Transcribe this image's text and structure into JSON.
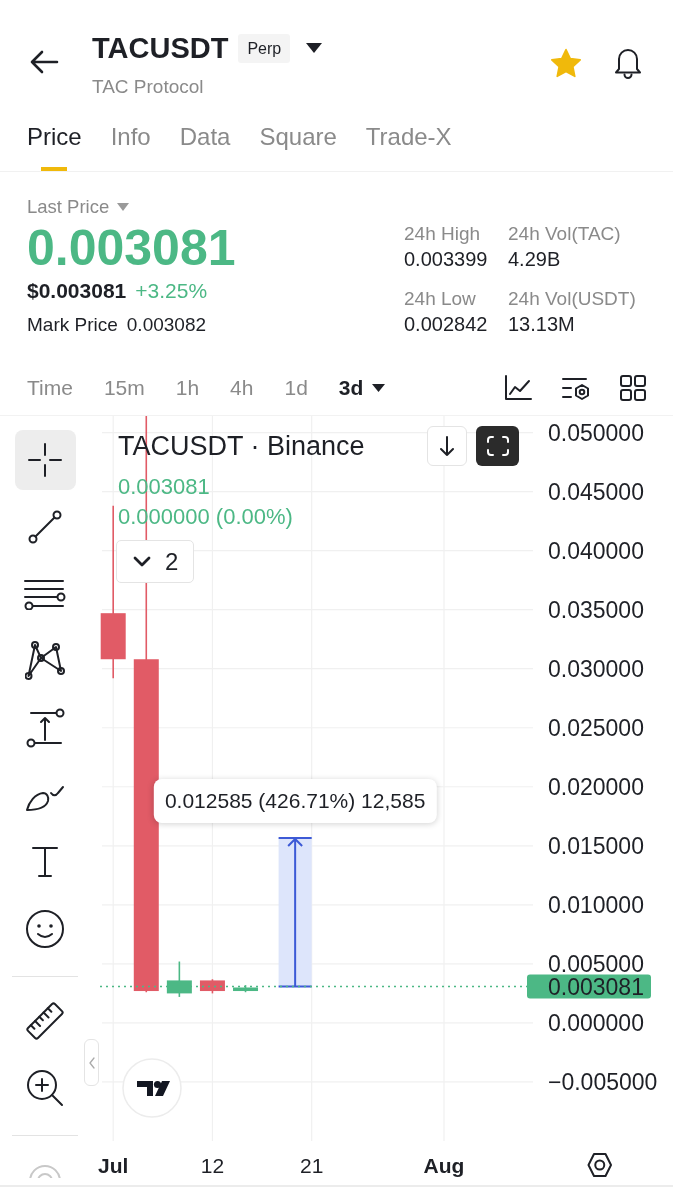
{
  "header": {
    "title": "TACUSDT",
    "badge": "Perp",
    "subtitle": "TAC Protocol",
    "favorite": true
  },
  "tabs": [
    {
      "label": "Price",
      "selected": true
    },
    {
      "label": "Info",
      "selected": false
    },
    {
      "label": "Data",
      "selected": false
    },
    {
      "label": "Square",
      "selected": false
    },
    {
      "label": "Trade-X",
      "selected": false
    }
  ],
  "ticker": {
    "label": "Last Price",
    "last_price": "0.003081",
    "rising": true,
    "usd_price": "$0.003081",
    "change": "+3.25%",
    "mark_label": "Mark Price",
    "mark_price": "0.003082"
  },
  "stats": [
    {
      "label": "24h High",
      "value": "0.003399"
    },
    {
      "label": "24h Vol(TAC)",
      "value": "4.29B"
    },
    {
      "label": "24h Low",
      "value": "0.002842"
    },
    {
      "label": "24h Vol(USDT)",
      "value": "13.13M"
    }
  ],
  "intervals": [
    {
      "label": "Time",
      "selected": false,
      "dropdown": false
    },
    {
      "label": "15m",
      "selected": false,
      "dropdown": false
    },
    {
      "label": "1h",
      "selected": false,
      "dropdown": false
    },
    {
      "label": "4h",
      "selected": false,
      "dropdown": false
    },
    {
      "label": "1d",
      "selected": false,
      "dropdown": false
    },
    {
      "label": "3d",
      "selected": true,
      "dropdown": true
    }
  ],
  "chart_tools": [
    {
      "kind": "chart_type"
    },
    {
      "kind": "indicators"
    },
    {
      "kind": "layout"
    }
  ],
  "drawing_toolbar": [
    {
      "tools": [
        {
          "kind": "crosshair",
          "selected": true
        },
        {
          "kind": "trend_line",
          "selected": false
        },
        {
          "kind": "parallel_lines",
          "selected": false
        },
        {
          "kind": "pattern",
          "selected": false
        },
        {
          "kind": "projection",
          "selected": false
        },
        {
          "kind": "brush",
          "selected": false
        },
        {
          "kind": "text",
          "selected": false
        },
        {
          "kind": "emoji",
          "selected": false
        }
      ]
    },
    {
      "tools": [
        {
          "kind": "ruler",
          "selected": false
        },
        {
          "kind": "zoom_in",
          "selected": false
        }
      ]
    },
    {
      "tools": [
        {
          "kind": "circle",
          "selected": false
        }
      ]
    }
  ],
  "chart": {
    "legend": {
      "title": "TACUSDT · Binance",
      "price": "0.003081",
      "change": "0.000000 (0.00%)",
      "rising": true,
      "indicator_count": "2"
    },
    "price_axis_labels": [
      "0.050000",
      "0.045000",
      "0.040000",
      "0.035000",
      "0.030000",
      "0.025000",
      "0.020000",
      "0.015000",
      "0.010000",
      "0.005000",
      "0.000000",
      "−0.005000"
    ],
    "time_axis_labels": [
      {
        "label": "Jul",
        "bold": true
      },
      {
        "label": "12",
        "bold": false
      },
      {
        "label": "21",
        "bold": false
      },
      {
        "label": "Aug",
        "bold": true
      }
    ],
    "last_price_tag": "0.003081",
    "measure_label": "0.012585 (426.71%) 12,585"
  }
}
